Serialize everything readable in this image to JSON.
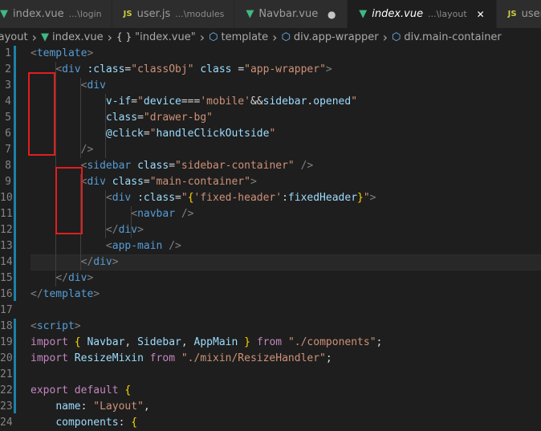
{
  "tabs": [
    {
      "icon": "vue-icon",
      "name": "index.vue",
      "dir": "...\\login",
      "active": false,
      "indicator": ""
    },
    {
      "icon": "js-icon",
      "name": "user.js",
      "dir": "...\\modules",
      "active": false,
      "indicator": ""
    },
    {
      "icon": "vue-icon",
      "name": "Navbar.vue",
      "dir": "",
      "active": false,
      "indicator": "●"
    },
    {
      "icon": "vue-icon",
      "name": "index.vue",
      "dir": "...\\layout",
      "active": true,
      "indicator": "✕"
    },
    {
      "icon": "js-icon",
      "name": "user.js",
      "dir": "",
      "active": false,
      "indicator": ""
    }
  ],
  "breadcrumbs": [
    {
      "icon": "",
      "label": "layout"
    },
    {
      "icon": "vue-icon",
      "label": "index.vue"
    },
    {
      "icon": "braces-icon",
      "label": "\"index.vue\""
    },
    {
      "icon": "cube-icon",
      "label": "template"
    },
    {
      "icon": "cube-icon",
      "label": "div.app-wrapper"
    },
    {
      "icon": "cube-icon",
      "label": "div.main-container"
    }
  ],
  "lines": [
    {
      "n": "1",
      "tokens": [
        [
          "t",
          "<"
        ],
        [
          "tn",
          "template"
        ],
        [
          "t",
          ">"
        ]
      ]
    },
    {
      "n": "2",
      "tokens": [
        [
          "op",
          "    "
        ],
        [
          "t",
          "<"
        ],
        [
          "tn",
          "div"
        ],
        [
          "op",
          " "
        ],
        [
          "an",
          ":class"
        ],
        [
          "op",
          "="
        ],
        [
          "av",
          "\"classObj\""
        ],
        [
          "op",
          " "
        ],
        [
          "an",
          "class"
        ],
        [
          "op",
          " ="
        ],
        [
          "av",
          "\"app-wrapper\""
        ],
        [
          "t",
          ">"
        ]
      ]
    },
    {
      "n": "3",
      "tokens": [
        [
          "op",
          "        "
        ],
        [
          "t",
          "<"
        ],
        [
          "tn",
          "div"
        ]
      ]
    },
    {
      "n": "4",
      "tokens": [
        [
          "op",
          "            "
        ],
        [
          "an",
          "v-if"
        ],
        [
          "op",
          "="
        ],
        [
          "av",
          "\""
        ],
        [
          "vr",
          "device"
        ],
        [
          "op",
          "==="
        ],
        [
          "av",
          "'mobile'"
        ],
        [
          "op",
          "&&"
        ],
        [
          "vr",
          "sidebar"
        ],
        [
          "op",
          "."
        ],
        [
          "vr",
          "opened"
        ],
        [
          "av",
          "\""
        ]
      ]
    },
    {
      "n": "5",
      "tokens": [
        [
          "op",
          "            "
        ],
        [
          "an",
          "class"
        ],
        [
          "op",
          "="
        ],
        [
          "av",
          "\"drawer-bg\""
        ]
      ]
    },
    {
      "n": "6",
      "tokens": [
        [
          "op",
          "            "
        ],
        [
          "an",
          "@click"
        ],
        [
          "op",
          "="
        ],
        [
          "av",
          "\""
        ],
        [
          "vr",
          "handleClickOutside"
        ],
        [
          "av",
          "\""
        ]
      ]
    },
    {
      "n": "7",
      "tokens": [
        [
          "op",
          "        "
        ],
        [
          "t",
          "/>"
        ]
      ]
    },
    {
      "n": "8",
      "tokens": [
        [
          "op",
          "        "
        ],
        [
          "t",
          "<"
        ],
        [
          "tn",
          "sidebar"
        ],
        [
          "op",
          " "
        ],
        [
          "an",
          "class"
        ],
        [
          "op",
          "="
        ],
        [
          "av",
          "\"sidebar-container\""
        ],
        [
          "op",
          " "
        ],
        [
          "t",
          "/>"
        ]
      ]
    },
    {
      "n": "9",
      "tokens": [
        [
          "op",
          "        "
        ],
        [
          "t",
          "<"
        ],
        [
          "tn",
          "div"
        ],
        [
          "op",
          " "
        ],
        [
          "an",
          "class"
        ],
        [
          "op",
          "="
        ],
        [
          "av",
          "\"main-container\""
        ],
        [
          "t",
          ">"
        ]
      ]
    },
    {
      "n": "10",
      "tokens": [
        [
          "op",
          "            "
        ],
        [
          "t",
          "<"
        ],
        [
          "tn",
          "div"
        ],
        [
          "op",
          " "
        ],
        [
          "an",
          ":class"
        ],
        [
          "op",
          "="
        ],
        [
          "av",
          "\""
        ],
        [
          "br",
          "{"
        ],
        [
          "av",
          "'fixed-header'"
        ],
        [
          "op",
          ":"
        ],
        [
          "vr",
          "fixedHeader"
        ],
        [
          "br",
          "}"
        ],
        [
          "av",
          "\""
        ],
        [
          "t",
          ">"
        ]
      ]
    },
    {
      "n": "11",
      "tokens": [
        [
          "op",
          "                "
        ],
        [
          "t",
          "<"
        ],
        [
          "tn",
          "navbar"
        ],
        [
          "op",
          " "
        ],
        [
          "t",
          "/>"
        ]
      ]
    },
    {
      "n": "12",
      "tokens": [
        [
          "op",
          "            "
        ],
        [
          "t",
          "</"
        ],
        [
          "tn",
          "div"
        ],
        [
          "t",
          ">"
        ]
      ]
    },
    {
      "n": "13",
      "tokens": [
        [
          "op",
          "            "
        ],
        [
          "t",
          "<"
        ],
        [
          "tn",
          "app-main"
        ],
        [
          "op",
          " "
        ],
        [
          "t",
          "/>"
        ]
      ]
    },
    {
      "n": "14",
      "tokens": [
        [
          "op",
          "        "
        ],
        [
          "t",
          "</"
        ],
        [
          "tn",
          "div"
        ],
        [
          "t",
          ">"
        ]
      ]
    },
    {
      "n": "15",
      "tokens": [
        [
          "op",
          "    "
        ],
        [
          "t",
          "</"
        ],
        [
          "tn",
          "div"
        ],
        [
          "t",
          ">"
        ]
      ]
    },
    {
      "n": "16",
      "tokens": [
        [
          "t",
          "</"
        ],
        [
          "tn",
          "template"
        ],
        [
          "t",
          ">"
        ]
      ]
    },
    {
      "n": "17",
      "tokens": []
    },
    {
      "n": "18",
      "tokens": [
        [
          "t",
          "<"
        ],
        [
          "tn",
          "script"
        ],
        [
          "t",
          ">"
        ]
      ]
    },
    {
      "n": "19",
      "tokens": [
        [
          "kw",
          "import"
        ],
        [
          "op",
          " "
        ],
        [
          "br",
          "{"
        ],
        [
          "op",
          " "
        ],
        [
          "vr",
          "Navbar"
        ],
        [
          "op",
          ", "
        ],
        [
          "vr",
          "Sidebar"
        ],
        [
          "op",
          ", "
        ],
        [
          "vr",
          "AppMain"
        ],
        [
          "op",
          " "
        ],
        [
          "br",
          "}"
        ],
        [
          "op",
          " "
        ],
        [
          "kw",
          "from"
        ],
        [
          "op",
          " "
        ],
        [
          "av",
          "\"./components\""
        ],
        [
          "op",
          ";"
        ]
      ]
    },
    {
      "n": "20",
      "tokens": [
        [
          "kw",
          "import"
        ],
        [
          "op",
          " "
        ],
        [
          "vr",
          "ResizeMixin"
        ],
        [
          "op",
          " "
        ],
        [
          "kw",
          "from"
        ],
        [
          "op",
          " "
        ],
        [
          "av",
          "\"./mixin/ResizeHandler\""
        ],
        [
          "op",
          ";"
        ]
      ]
    },
    {
      "n": "21",
      "tokens": []
    },
    {
      "n": "22",
      "tokens": [
        [
          "kw",
          "export"
        ],
        [
          "op",
          " "
        ],
        [
          "kw",
          "default"
        ],
        [
          "op",
          " "
        ],
        [
          "br",
          "{"
        ]
      ]
    },
    {
      "n": "23",
      "tokens": [
        [
          "op",
          "    "
        ],
        [
          "vr",
          "name"
        ],
        [
          "op",
          ": "
        ],
        [
          "av",
          "\"Layout\""
        ],
        [
          "op",
          ","
        ]
      ]
    },
    {
      "n": "24",
      "tokens": [
        [
          "op",
          "    "
        ],
        [
          "vr",
          "components"
        ],
        [
          "op",
          ": "
        ],
        [
          "br",
          "{"
        ]
      ]
    }
  ]
}
